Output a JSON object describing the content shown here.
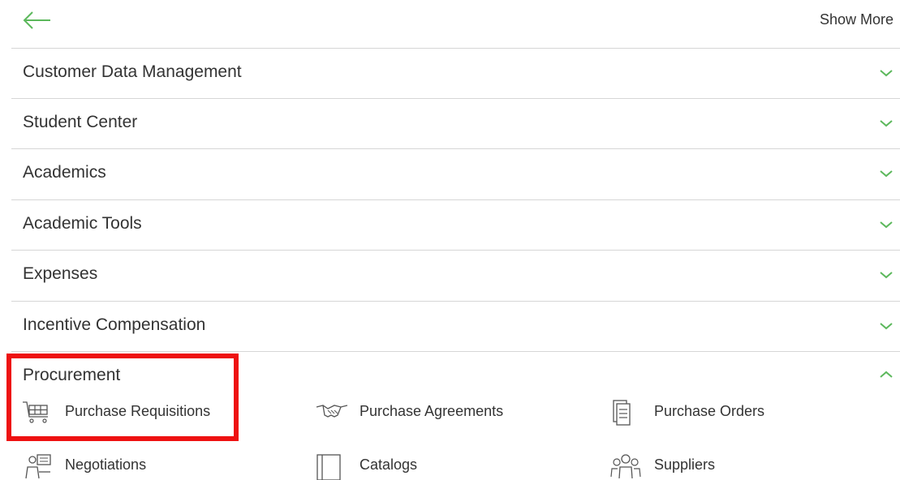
{
  "header": {
    "show_more_label": "Show More"
  },
  "sections": [
    {
      "label": "Customer Data Management"
    },
    {
      "label": "Student Center"
    },
    {
      "label": "Academics"
    },
    {
      "label": "Academic Tools"
    },
    {
      "label": "Expenses"
    },
    {
      "label": "Incentive Compensation"
    }
  ],
  "procurement": {
    "label": "Procurement",
    "expanded": true,
    "tiles": [
      {
        "label": "Purchase Requisitions",
        "icon": "shopping-cart-icon"
      },
      {
        "label": "Purchase Agreements",
        "icon": "handshake-icon"
      },
      {
        "label": "Purchase Orders",
        "icon": "document-list-icon"
      },
      {
        "label": "Negotiations",
        "icon": "negotiation-icon"
      },
      {
        "label": "Catalogs",
        "icon": "catalog-icon"
      },
      {
        "label": "Suppliers",
        "icon": "suppliers-icon"
      }
    ]
  },
  "colors": {
    "accent": "#5cb85c",
    "highlight": "#ee1111",
    "divider": "#d6d6d6"
  }
}
